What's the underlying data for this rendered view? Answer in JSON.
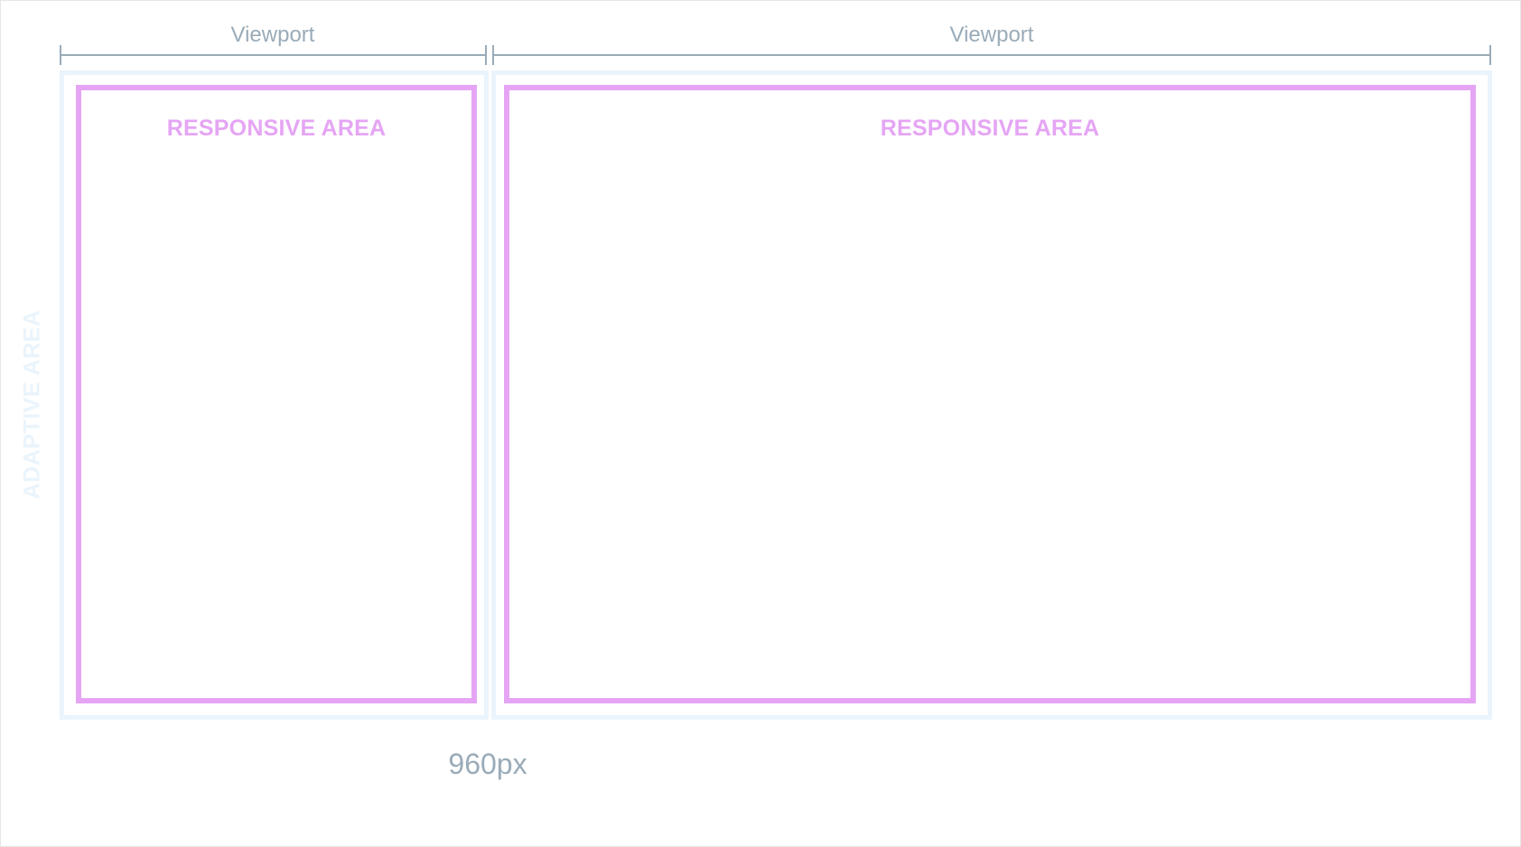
{
  "viewports": [
    {
      "label": "Viewport",
      "area_label": "RESPONSIVE AREA"
    },
    {
      "label": "Viewport",
      "area_label": "RESPONSIVE AREA"
    }
  ],
  "adaptive_label": "ADAPTIVE AREA",
  "breakpoint_label": "960px",
  "colors": {
    "dimension": "#9aabb8",
    "responsive": "#e5a5f4",
    "adaptive": "#eaf4fc"
  }
}
